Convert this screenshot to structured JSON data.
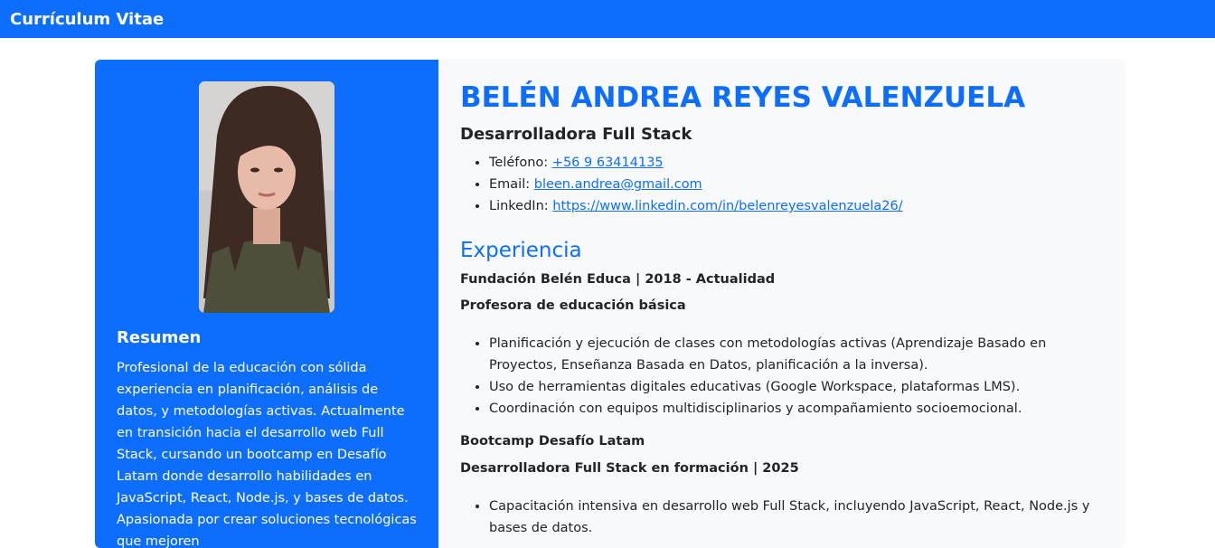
{
  "navbar": {
    "brand": "Currículum Vitae"
  },
  "sidebar": {
    "summary_title": "Resumen",
    "summary_text": "Profesional de la educación con sólida experiencia en planificación, análisis de datos, y metodologías activas. Actualmente en transición hacia el desarrollo web Full Stack, cursando un bootcamp en Desafío Latam donde desarrollo habilidades en JavaScript, React, Node.js, y bases de datos. Apasionada por crear soluciones tecnológicas que mejoren"
  },
  "profile": {
    "name": "BELÉN ANDREA REYES VALENZUELA",
    "role": "Desarrolladora Full Stack",
    "contacts": [
      {
        "label": "Teléfono: ",
        "value": "+56 9 63414135"
      },
      {
        "label": "Email: ",
        "value": "bleen.andrea@gmail.com"
      },
      {
        "label": "LinkedIn: ",
        "value": "https://www.linkedin.com/in/belenreyesvalenzuela26/"
      }
    ]
  },
  "experience": {
    "title": "Experiencia",
    "jobs": [
      {
        "org": "Fundación Belén Educa | 2018 - Actualidad",
        "role": "Profesora de educación básica",
        "items": [
          "Planificación y ejecución de clases con metodologías activas (Aprendizaje Basado en Proyectos, Enseñanza Basada en Datos, planificación a la inversa).",
          "Uso de herramientas digitales educativas (Google Workspace, plataformas LMS).",
          "Coordinación con equipos multidisciplinarios y acompañamiento socioemocional."
        ]
      },
      {
        "org": "Bootcamp Desafío Latam",
        "role": "Desarrolladora Full Stack en formación | 2025",
        "items": [
          "Capacitación intensiva en desarrollo web Full Stack, incluyendo JavaScript, React, Node.js y bases de datos."
        ]
      }
    ]
  }
}
